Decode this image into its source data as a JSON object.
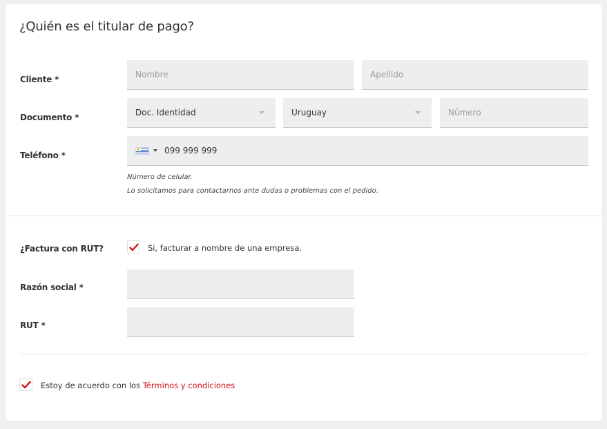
{
  "section_title": "¿Quién es el titular de pago?",
  "cliente": {
    "label": "Cliente *",
    "first_name_placeholder": "Nombre",
    "last_name_placeholder": "Apellido"
  },
  "documento": {
    "label": "Documento *",
    "doc_type_value": "Doc. Identidad",
    "country_value": "Uruguay",
    "number_placeholder": "Número"
  },
  "telefono": {
    "label": "Teléfono *",
    "flag_icon": "uruguay-flag-icon",
    "phone_value": "099 999 999",
    "hint_line1": "Número de celular.",
    "hint_line2": "Lo solicitamos para contactarnos ante dudas o problemas con el pedido."
  },
  "factura": {
    "label": "¿Factura con RUT?",
    "checkbox_label": "Si, facturar a nombre de una empresa.",
    "checked": true
  },
  "razon_social": {
    "label": "Razón social *",
    "value": ""
  },
  "rut": {
    "label": "RUT *",
    "value": ""
  },
  "terms": {
    "text_prefix": "Estoy de acuerdo con los ",
    "link_text": "Términos y condiciones",
    "checked": true
  },
  "colors": {
    "accent": "#d4131b",
    "field_bg": "#eeeeee"
  }
}
